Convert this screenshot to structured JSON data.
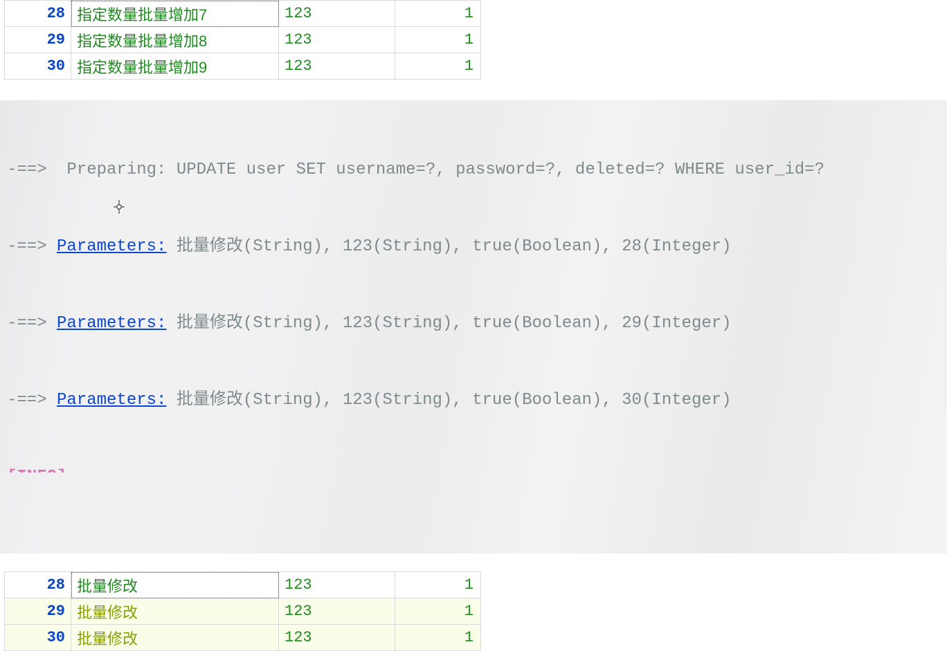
{
  "table_before": {
    "rows": [
      {
        "id": "28",
        "name": "指定数量批量增加7",
        "pass": "123",
        "del": "1",
        "sel": true
      },
      {
        "id": "29",
        "name": "指定数量批量增加8",
        "pass": "123",
        "del": "1",
        "sel": false
      },
      {
        "id": "30",
        "name": "指定数量批量增加9",
        "pass": "123",
        "del": "1",
        "sel": false
      }
    ]
  },
  "log": {
    "arrow": "-==>",
    "prep_label": "  Preparing:",
    "prep_sql": " UPDATE user SET username=?, password=?, deleted=? WHERE user_id=?",
    "param_label": "Parameters:",
    "params": [
      " 批量修改(String), 123(String), true(Boolean), 28(Integer)",
      " 批量修改(String), 123(String), true(Boolean), 29(Integer)",
      " 批量修改(String), 123(String), true(Boolean), 30(Integer)"
    ],
    "info_tag": "[INFO]"
  },
  "table_after": {
    "rows": [
      {
        "id": "28",
        "name": "批量修改",
        "pass": "123",
        "del": "1",
        "first": true
      },
      {
        "id": "29",
        "name": "批量修改",
        "pass": "123",
        "del": "1",
        "first": false
      },
      {
        "id": "30",
        "name": "批量修改",
        "pass": "123",
        "del": "1",
        "first": false
      }
    ]
  }
}
